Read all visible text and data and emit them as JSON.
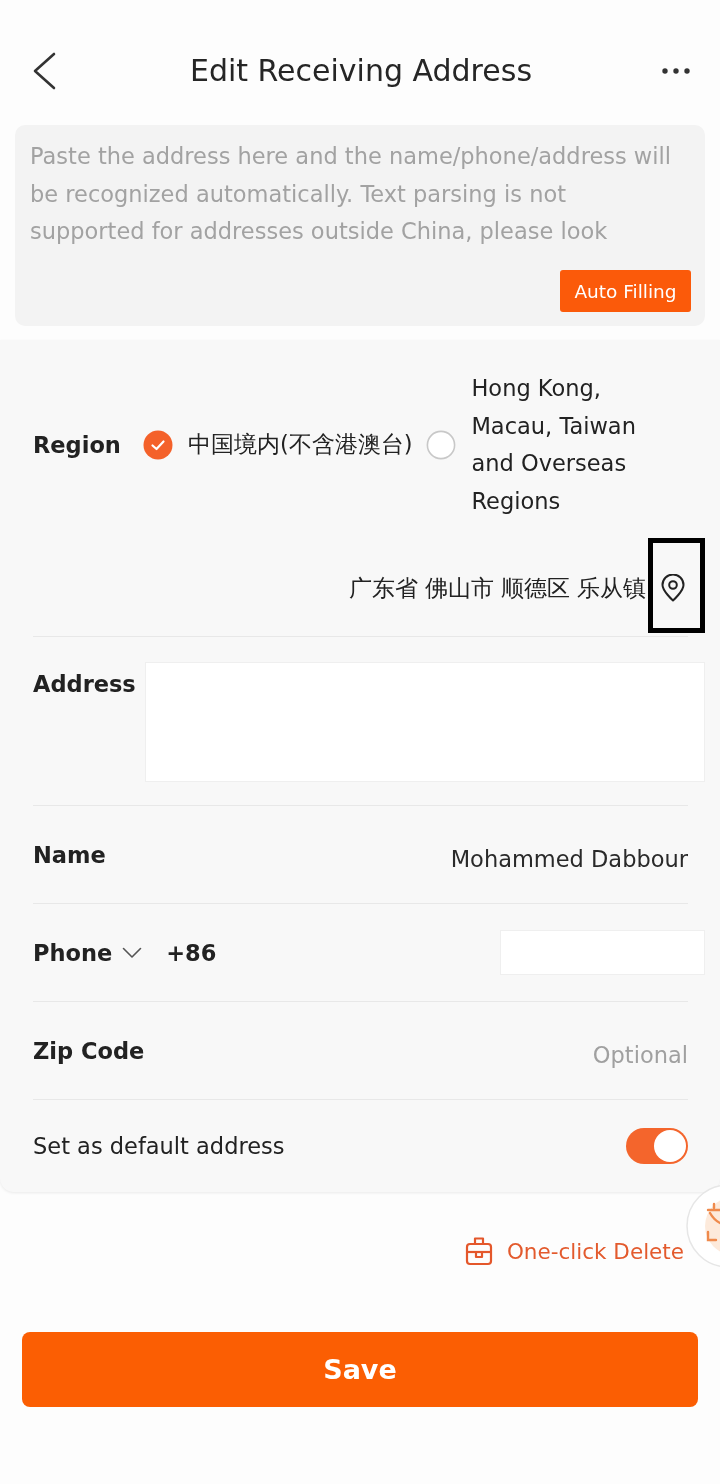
{
  "header": {
    "title": "Edit Receiving Address"
  },
  "paste_box": {
    "placeholder": "Paste the address here and the name/phone/address will be recognized automatically. Text parsing is not supported for addresses outside China, please look",
    "button": "Auto Filling"
  },
  "form": {
    "region": {
      "label": "Region",
      "options": [
        {
          "label": "中国境内(不含港澳台)",
          "selected": true
        },
        {
          "label": "Hong Kong, Macau, Taiwan and Overseas Regions",
          "selected": false
        }
      ]
    },
    "location": {
      "value": "广东省 佛山市 顺德区 乐从镇",
      "highlighted": true
    },
    "fields": [
      {
        "kind": "textarea",
        "label": "Address"
      },
      {
        "kind": "text",
        "label": "Name",
        "value": "Mohammed Dabbour"
      },
      {
        "kind": "phone",
        "label": "Phone",
        "code": "+86"
      },
      {
        "kind": "text",
        "label": "Zip Code",
        "placeholder": "Optional"
      },
      {
        "kind": "toggle",
        "label": "Set as default address",
        "on": true
      }
    ]
  },
  "delete_link": "One-click Delete",
  "save_button": "Save"
}
